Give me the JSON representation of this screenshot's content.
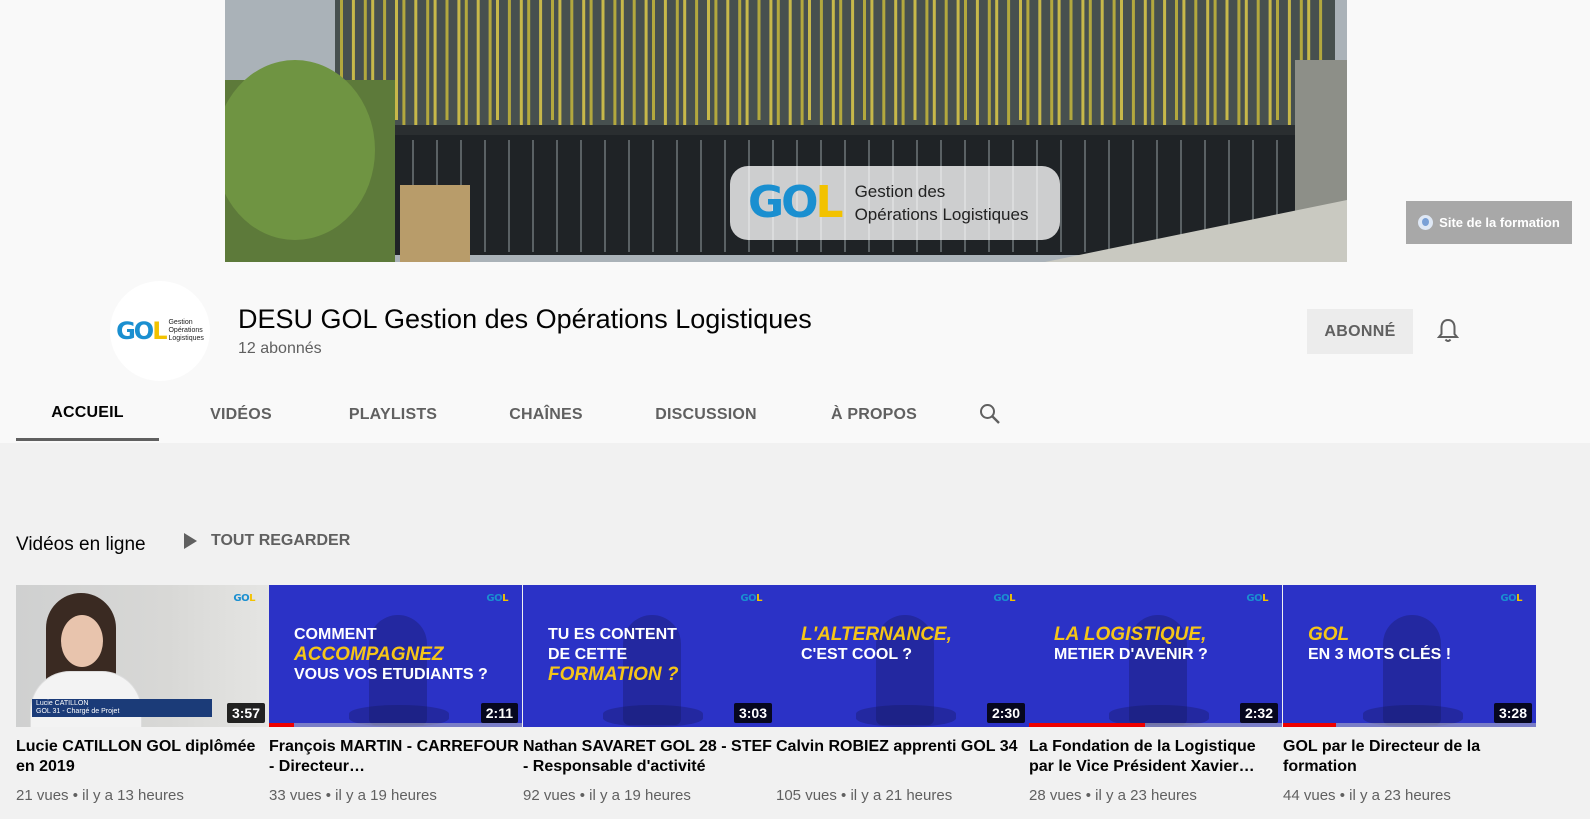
{
  "banner": {
    "logo_mark": {
      "g": "G",
      "o": "O",
      "l": "L"
    },
    "line1": "Gestion des",
    "line2": "Opérations Logistiques",
    "site_link": "Site de la formation"
  },
  "channel": {
    "avatar_lines": [
      "Gestion",
      "Opérations",
      "Logistiques"
    ],
    "title": "DESU GOL Gestion des Opérations Logistiques",
    "subscribers": "12 abonnés",
    "subscribe_label": "ABONNÉ"
  },
  "tabs": [
    {
      "label": "ACCUEIL",
      "active": true
    },
    {
      "label": "VIDÉOS",
      "active": false
    },
    {
      "label": "PLAYLISTS",
      "active": false
    },
    {
      "label": "CHAÎNES",
      "active": false
    },
    {
      "label": "DISCUSSION",
      "active": false
    },
    {
      "label": "À PROPOS",
      "active": false
    }
  ],
  "shelf": {
    "title": "Vidéos en ligne",
    "play_all": "TOUT REGARDER",
    "videos": [
      {
        "thumb_logo": "GOL",
        "thumb_lines": [],
        "caption_name": "Lucie CATILLON",
        "caption_role": "GOL 31 - Chargé de Projet",
        "duration": "3:57",
        "progress": 0,
        "title": "Lucie CATILLON GOL diplômée en 2019",
        "meta": "21 vues • il y a 13 heures"
      },
      {
        "thumb_logo": "GOL",
        "thumb_lines": [
          {
            "text": "Comment",
            "style": "white"
          },
          {
            "text": "accompagnez",
            "style": "yellow"
          },
          {
            "text": "vous vos etudiants ?",
            "style": "white"
          }
        ],
        "duration": "2:11",
        "progress": 0.1,
        "title": "François MARTIN - CARREFOUR - Directeur…",
        "meta": "33 vues • il y a 19 heures"
      },
      {
        "thumb_logo": "GOL",
        "thumb_lines": [
          {
            "text": "Tu es content",
            "style": "white"
          },
          {
            "text": "de cette",
            "style": "white"
          },
          {
            "text": "formation ?",
            "style": "yellow"
          }
        ],
        "duration": "3:03",
        "progress": 0,
        "title": "Nathan SAVARET GOL 28 - STEF - Responsable d'activité",
        "meta": "92 vues • il y a 19 heures"
      },
      {
        "thumb_logo": "GOL",
        "thumb_lines": [
          {
            "text": "L'alternance,",
            "style": "yellow"
          },
          {
            "text": "c'est cool ?",
            "style": "white"
          }
        ],
        "duration": "2:30",
        "progress": 0,
        "title": "Calvin ROBIEZ apprenti GOL 34",
        "meta": "105 vues • il y a 21 heures"
      },
      {
        "thumb_logo": "GOL",
        "thumb_lines": [
          {
            "text": "La logistique,",
            "style": "yellow"
          },
          {
            "text": "metier d'avenir ?",
            "style": "white"
          }
        ],
        "duration": "2:32",
        "progress": 0.46,
        "title": "La Fondation de la Logistique par le Vice Président Xavier…",
        "meta": "28 vues • il y a 23 heures"
      },
      {
        "thumb_logo": "GOL",
        "thumb_lines": [
          {
            "text": "GOL",
            "style": "yellow"
          },
          {
            "text": "en 3 mots clés !",
            "style": "white"
          }
        ],
        "duration": "3:28",
        "progress": 0.21,
        "title": "GOL par le Directeur de la formation",
        "meta": "44 vues • il y a 23 heures"
      }
    ]
  },
  "colors": {
    "thumb_blue": "#2b32c6",
    "accent_yellow": "#f5c518",
    "progress_red": "#e00000",
    "gol_blue": "#1a8fd0",
    "gol_yellow": "#f2c200"
  }
}
